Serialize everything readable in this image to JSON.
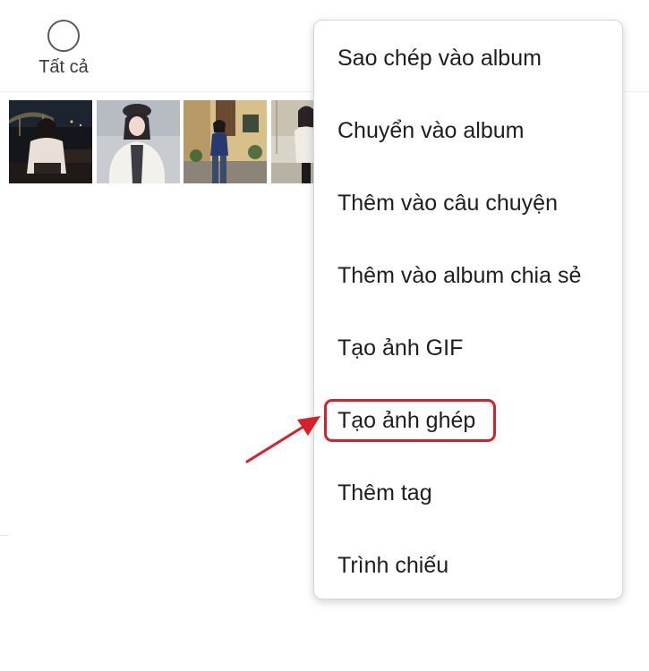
{
  "header": {
    "select_all_label": "Tất cả"
  },
  "thumbnails": [
    {
      "name": "photo-night-bridge"
    },
    {
      "name": "photo-white-fur-coat"
    },
    {
      "name": "photo-blue-cardigan-street"
    },
    {
      "name": "photo-partial-street"
    }
  ],
  "menu": {
    "items": [
      {
        "label": "Sao chép vào album"
      },
      {
        "label": "Chuyển vào album"
      },
      {
        "label": "Thêm vào câu chuyện"
      },
      {
        "label": "Thêm vào album chia sẻ"
      },
      {
        "label": "Tạo ảnh GIF"
      },
      {
        "label": "Tạo ảnh ghép"
      },
      {
        "label": "Thêm tag"
      },
      {
        "label": "Trình chiếu"
      }
    ],
    "highlighted_index": 5
  },
  "colors": {
    "annotation": "#d6202a",
    "menu_text": "#1e1e1e",
    "header_text": "#3a3a3a"
  },
  "icons": {
    "select_all": "circle-outline-icon",
    "pointer": "red-arrow-icon"
  }
}
